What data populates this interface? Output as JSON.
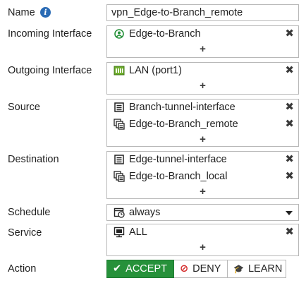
{
  "labels": {
    "name": "Name",
    "incoming": "Incoming Interface",
    "outgoing": "Outgoing Interface",
    "source": "Source",
    "destination": "Destination",
    "schedule": "Schedule",
    "service": "Service",
    "action": "Action"
  },
  "name_value": "vpn_Edge-to-Branch_remote",
  "incoming": {
    "items": [
      {
        "label": "Edge-to-Branch",
        "icon": "tunnel-icon"
      }
    ]
  },
  "outgoing": {
    "items": [
      {
        "label": "LAN (port1)",
        "icon": "port-icon"
      }
    ]
  },
  "source": {
    "items": [
      {
        "label": "Branch-tunnel-interface",
        "icon": "address-icon"
      },
      {
        "label": "Edge-to-Branch_remote",
        "icon": "address-group-icon"
      }
    ]
  },
  "destination": {
    "items": [
      {
        "label": "Edge-tunnel-interface",
        "icon": "address-icon"
      },
      {
        "label": "Edge-to-Branch_local",
        "icon": "address-group-icon"
      }
    ]
  },
  "schedule": {
    "value": "always",
    "icon": "schedule-icon"
  },
  "service": {
    "items": [
      {
        "label": "ALL",
        "icon": "service-icon"
      }
    ]
  },
  "glyphs": {
    "remove": "✖",
    "add": "+"
  },
  "action": {
    "selected": "accept",
    "buttons": [
      {
        "id": "accept",
        "label": "ACCEPT",
        "icon": "check-icon",
        "glyph": "✔"
      },
      {
        "id": "deny",
        "label": "DENY",
        "icon": "deny-icon",
        "glyph": "⊘"
      },
      {
        "id": "learn",
        "label": "LEARN",
        "icon": "graduation-cap-icon",
        "glyph": "🎓"
      }
    ]
  },
  "colors": {
    "accept_green": "#26913a",
    "deny_red": "#d42a2a",
    "info_blue": "#2a6bb5"
  }
}
